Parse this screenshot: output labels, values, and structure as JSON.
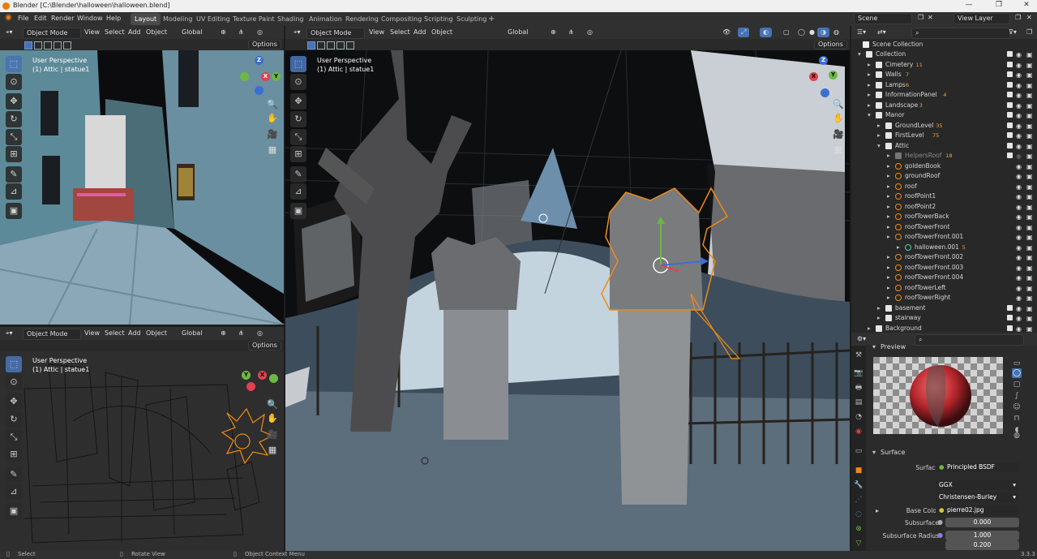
{
  "window": {
    "title": "Blender [C:\\Blender\\halloween\\halloween.blend]",
    "minimize": "—",
    "maximize": "❐",
    "close": "✕"
  },
  "menu": [
    "File",
    "Edit",
    "Render",
    "Window",
    "Help"
  ],
  "workspaces": [
    "Layout",
    "Modeling",
    "UV Editing",
    "Texture Paint",
    "Shading",
    "Animation",
    "Rendering",
    "Compositing",
    "Scripting",
    "Sculpting"
  ],
  "active_workspace": "Layout",
  "add_workspace": "+",
  "scene": "Scene",
  "view_layer": "View Layer",
  "viewport_header": {
    "mode": "Object Mode",
    "view": "View",
    "select": "Select",
    "add": "Add",
    "object": "Object",
    "orientation": "Global",
    "options": "Options"
  },
  "viewports": {
    "top_left": {
      "perspective": "User Perspective",
      "context": "(1) Attic | statue1"
    },
    "bottom_left": {
      "perspective": "User Perspective",
      "context": "(1) Attic | statue1"
    },
    "main": {
      "perspective": "User Perspective",
      "context": "(1) Attic | statue1"
    }
  },
  "gizmo_axes": {
    "x": "X",
    "y": "Y",
    "z": "Z"
  },
  "outliner": {
    "root": "Scene Collection",
    "rows": [
      {
        "name": "Collection",
        "depth": 0,
        "icon": "collection"
      },
      {
        "name": "Cimetery",
        "depth": 1,
        "icon": "collection",
        "badge": "11"
      },
      {
        "name": "Walls",
        "depth": 1,
        "icon": "collection",
        "badge": "7"
      },
      {
        "name": "Lamps",
        "depth": 1,
        "icon": "collection",
        "badge": "6"
      },
      {
        "name": "InformationPanel",
        "depth": 1,
        "icon": "collection",
        "badge": "4"
      },
      {
        "name": "Landscape",
        "depth": 1,
        "icon": "collection",
        "badge": "3"
      },
      {
        "name": "Manor",
        "depth": 1,
        "icon": "collection"
      },
      {
        "name": "GroundLevel",
        "depth": 2,
        "icon": "collection",
        "badge": "35"
      },
      {
        "name": "FirstLevel",
        "depth": 2,
        "icon": "collection",
        "badge": "75"
      },
      {
        "name": "Attic",
        "depth": 2,
        "icon": "collection"
      },
      {
        "name": "HelpersRoof",
        "depth": 3,
        "icon": "collection",
        "badge": "18",
        "dim": true
      },
      {
        "name": "goldenBook",
        "depth": 3,
        "icon": "mesh"
      },
      {
        "name": "groundRoof",
        "depth": 3,
        "icon": "mesh"
      },
      {
        "name": "roof",
        "depth": 3,
        "icon": "mesh"
      },
      {
        "name": "roofPoint1",
        "depth": 3,
        "icon": "mesh"
      },
      {
        "name": "roofPoint2",
        "depth": 3,
        "icon": "mesh"
      },
      {
        "name": "roofTowerBack",
        "depth": 3,
        "icon": "mesh"
      },
      {
        "name": "roofTowerFront",
        "depth": 3,
        "icon": "mesh"
      },
      {
        "name": "roofTowerFront.001",
        "depth": 3,
        "icon": "mesh"
      },
      {
        "name": "halloween.001",
        "depth": 4,
        "icon": "data",
        "badge": "5"
      },
      {
        "name": "roofTowerFront.002",
        "depth": 3,
        "icon": "mesh"
      },
      {
        "name": "roofTowerFront.003",
        "depth": 3,
        "icon": "mesh"
      },
      {
        "name": "roofTowerFront.004",
        "depth": 3,
        "icon": "mesh"
      },
      {
        "name": "roofTowerLeft",
        "depth": 3,
        "icon": "mesh"
      },
      {
        "name": "roofTowerRight",
        "depth": 3,
        "icon": "mesh"
      },
      {
        "name": "basement",
        "depth": 2,
        "icon": "collection"
      },
      {
        "name": "stairway",
        "depth": 2,
        "icon": "collection"
      },
      {
        "name": "Background",
        "depth": 1,
        "icon": "collection"
      }
    ]
  },
  "properties": {
    "preview": "Preview",
    "surface_section": "Surface",
    "surface_label": "Surface",
    "surface_value": "Principled BSDF",
    "distribution": "GGX",
    "subsurface_method": "Christensen-Burley",
    "base_color_label": "Base Color",
    "base_color_value": "pierre02.jpg",
    "subsurface_label": "Subsurface",
    "subsurface_value": "0.000",
    "subsurface_radius_label": "Subsurface Radius",
    "subsurface_radius_1": "1.000",
    "subsurface_radius_2": "0.200"
  },
  "status": {
    "select": "Select",
    "rotate": "Rotate View",
    "context": "Object Context Menu",
    "version": "3.3.3"
  }
}
